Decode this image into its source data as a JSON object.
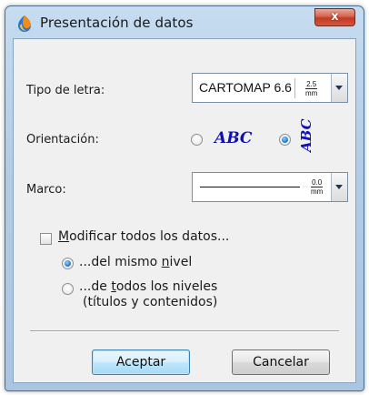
{
  "window": {
    "title": "Presentación de datos",
    "close_glyph": "x"
  },
  "font": {
    "label": "Tipo de letra:",
    "value": "CARTOMAP 6.6",
    "size_num": "2.5",
    "size_unit": "mm"
  },
  "orientation": {
    "label": "Orientación:",
    "horizontal_text": "ABC",
    "vertical_text": "ABC",
    "selected": "vertical"
  },
  "frame": {
    "label": "Marco:",
    "size_num": "0.0",
    "size_unit": "mm"
  },
  "modify": {
    "checkbox_label_first": "M",
    "checkbox_label_rest": "odificar todos los datos...",
    "checked": false,
    "option1_pre": "...del mismo ",
    "option1_u": "n",
    "option1_post": "ivel",
    "option2_pre": "...de ",
    "option2_u": "t",
    "option2_post": "odos los niveles",
    "option2_line2": "(títulos y contenidos)",
    "selected": "option1"
  },
  "buttons": {
    "ok": "Aceptar",
    "cancel": "Cancelar"
  },
  "colors": {
    "abc_blue": "#1010b8",
    "title_bar": "#b4cde6",
    "close_red": "#c23a22"
  }
}
